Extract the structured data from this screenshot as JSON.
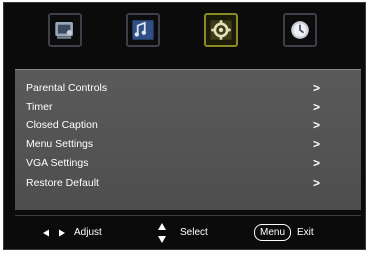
{
  "tabs": [
    {
      "icon": "picture-icon",
      "active": false
    },
    {
      "icon": "sound-icon",
      "active": false
    },
    {
      "icon": "setup-icon",
      "active": true
    },
    {
      "icon": "clock-icon",
      "active": false
    }
  ],
  "menu": {
    "items": [
      {
        "label": "Parental Controls",
        "arrow": ">"
      },
      {
        "label": "Timer",
        "arrow": ">"
      },
      {
        "label": "Closed Caption",
        "arrow": ">"
      },
      {
        "label": "Menu Settings",
        "arrow": ">"
      },
      {
        "label": "VGA Settings",
        "arrow": ">"
      },
      {
        "label": "Restore Default",
        "arrow": ">"
      }
    ]
  },
  "footer": {
    "adjust_label": "Adjust",
    "select_label": "Select",
    "menu_key_label": "Menu",
    "exit_label": "Exit"
  },
  "colors": {
    "background": "#0b0b0b",
    "panel": "#555555",
    "active_tab_border": "#8a8a22",
    "text": "#ffffff"
  }
}
